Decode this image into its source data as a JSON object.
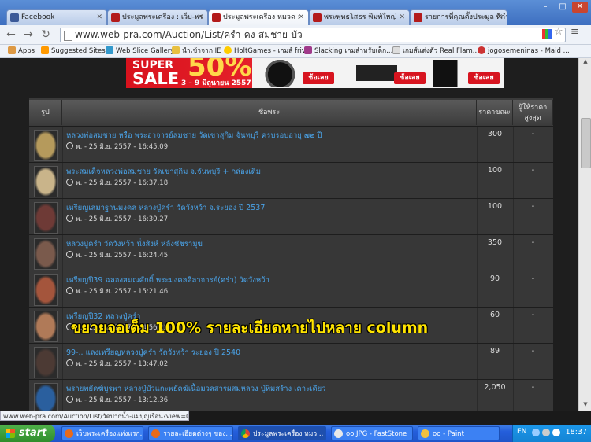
{
  "tabs": [
    {
      "label": "Facebook",
      "color": "#3b5998",
      "glyph": "f"
    },
    {
      "label": "ประมูลพระเครื่อง : เว็บ-พร",
      "color": "#b31b1b",
      "glyph": "W"
    },
    {
      "label": "ประมูลพระเครื่อง หมวด : ",
      "color": "#b31b1b",
      "glyph": "W"
    },
    {
      "label": "พระพุทธโสธร พิมพ์ใหญ่ |",
      "color": "#b31b1b",
      "glyph": "W"
    },
    {
      "label": "รายการที่คุณตั้งประมูล ที่กำ",
      "color": "#b31b1b",
      "glyph": "W"
    }
  ],
  "window_controls": [
    "–",
    "□",
    "✕"
  ],
  "address": {
    "url": "www.web-pra.com/Auction/List/ครำ-คง-สมชาย-บัว"
  },
  "bookmarks": [
    {
      "label": "Apps",
      "color": "#d94"
    },
    {
      "label": "Suggested Sites",
      "color": "#f90"
    },
    {
      "label": "Web Slice Gallery",
      "color": "#39c"
    },
    {
      "label": "นำเข้าจาก IE",
      "color": "#e8c040"
    },
    {
      "label": "HoltGames - เกมส์ friv",
      "color": "#fc0"
    },
    {
      "label": "Slacking เกมสำหรับเด็ก...",
      "color": "#a03a8a"
    },
    {
      "label": "เกมส์แต่งตัว Real Flam...",
      "color": "#ddd"
    },
    {
      "label": "jogosemeninas - Maid ...",
      "color": "#c33"
    }
  ],
  "banner": {
    "super": "SUPER",
    "sale": "SALE",
    "percent": "50%",
    "dates": "3 – 9 มิถุนายน 2557",
    "buy": "ช้อเลย"
  },
  "table": {
    "headers": {
      "image": "รูป",
      "name": "ชื่อพระ",
      "price": "ราคาขณะนี้",
      "bidder": "ผู้ให้ราคาสูงสุด"
    },
    "rows": [
      {
        "title": "หลวงพ่อสมชาย หรือ พระอาจารย์สมชาย วัดเขาสุกิม จันทบุรี ครบรอบอายุ ๗๒ ปี",
        "time": "พ. - 25 มิ.ย. 2557 - 16:45.09",
        "price": "300",
        "bidder": "-",
        "thumb": "#b59a5c"
      },
      {
        "title": "พระสมเด็จหลวงพ่อสมชาย วัดเขาสุกิม จ.จันทบุรี + กล่องเดิม",
        "time": "พ. - 25 มิ.ย. 2557 - 16:37.18",
        "price": "100",
        "bidder": "-",
        "thumb": "#c9b48a"
      },
      {
        "title": "เหรียญเสมาฐานมงคล หลวงปู่ครำ วัดวังหว้า จ.ระยอง ปี 2537",
        "time": "พ. - 25 มิ.ย. 2557 - 16:30.27",
        "price": "100",
        "bidder": "-",
        "thumb": "#6e3a36"
      },
      {
        "title": "หลวงปู่ครำ วัดวังหว้า นั่งสิงห์ หลังชัชรามุข",
        "time": "พ. - 25 มิ.ย. 2557 - 16:24.45",
        "price": "350",
        "bidder": "-",
        "thumb": "#7a5a4c"
      },
      {
        "title": "เหรียญปี39 ฉลองสมณศักดิ์ พระมงคลศีลาจารย์(ครำ) วัดวังหว้า",
        "time": "พ. - 25 มิ.ย. 2557 - 15:21.46",
        "price": "90",
        "bidder": "-",
        "thumb": "#a4553c"
      },
      {
        "title": "เหรียญปี32 หลวงปู่ครำ",
        "time": "พ. - 25 มิ.ย. 2557 - 14:56.23",
        "price": "60",
        "bidder": "-",
        "thumb": "#b07a58"
      },
      {
        "title": "99-.. แลงเหรียญหลวงปู่ครำ วัดวังหว้า ระยอง ปี 2540",
        "time": "พ. - 25 มิ.ย. 2557 - 13:47.02",
        "price": "89",
        "bidder": "-",
        "thumb": "#4c3a34"
      },
      {
        "title": "พรายพยัคฆ์บูรพา หลวงปู่บัวแกะพยัคฆ์เนื้อมวลสารผสมหลวง ปู่ทิมสร้าง เคาะเดียว",
        "time": "พ. - 25 มิ.ย. 2557 - 13:12.36",
        "price": "2,050",
        "bidder": "-",
        "thumb": "#2a5f9e"
      }
    ]
  },
  "overlay_text": "ขยายจอเต็ม 100% รายละเอียดหายไปหลาย column",
  "status_url": "www.web-pra.com/Auction/List/วัดปากน้ำ-แม่บุญเรือน?view=0#",
  "taskbar": {
    "start": "start",
    "buttons": [
      {
        "label": "เว็บพระเครื่องแห่งแรก...",
        "color": "#e86a1a"
      },
      {
        "label": "รายละเอียดต่างๆ ของ...",
        "color": "#e86a1a"
      },
      {
        "label": "ประมูลพระเครื่อง หมว...",
        "color": "#4caf50"
      },
      {
        "label": "oo.JPG - FastStone",
        "color": "#e8e8e8"
      },
      {
        "label": "oo - Paint",
        "color": "#f0c040"
      }
    ],
    "lang": "EN",
    "clock": "18:37"
  }
}
